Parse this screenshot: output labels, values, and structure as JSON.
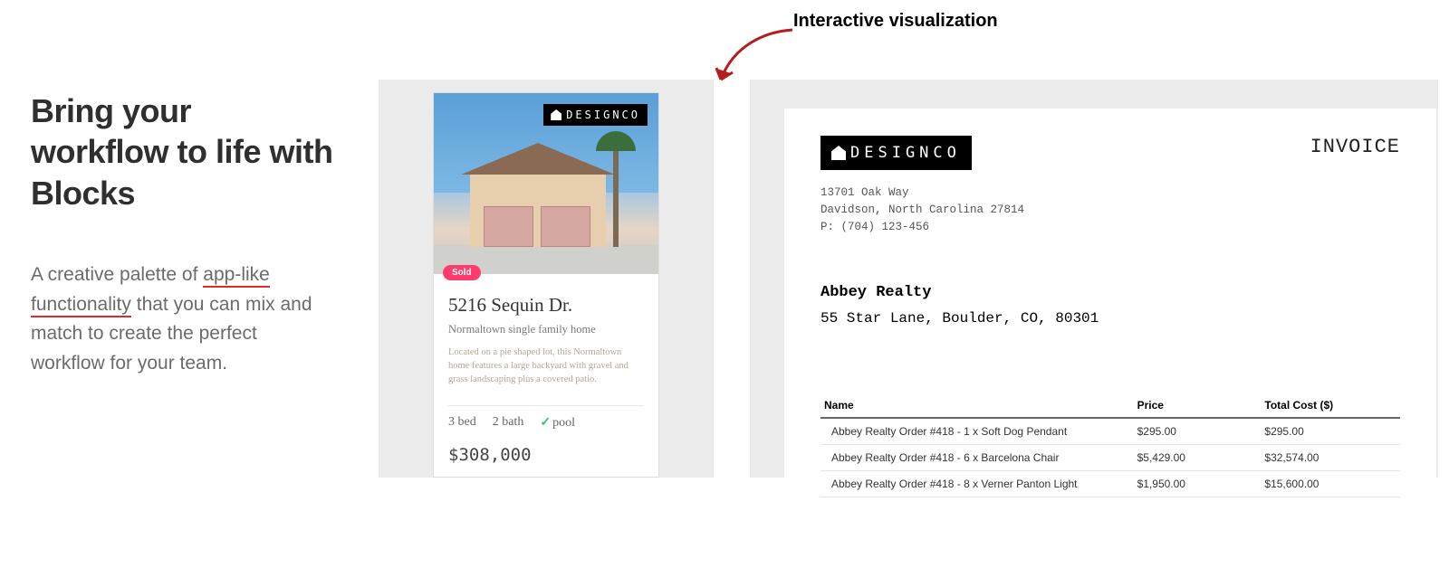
{
  "callout": {
    "label": "Interactive visualization"
  },
  "left": {
    "headline": "Bring your workflow to life with Blocks",
    "sub_pre": "A creative palette of ",
    "sub_link1": "app-like",
    "sub_mid": " ",
    "sub_link2": "functionality",
    "sub_post": " that you can mix and match to create the perfect workflow for your team."
  },
  "brand": {
    "name": "DESIGNCO"
  },
  "listing": {
    "sold_label": "Sold",
    "title": "5216 Sequin Dr.",
    "subtitle": "Normaltown single family home",
    "description": "Located on a pie shaped lot, this Normaltown home features a large backyard with gravel and grass landscaping plus a covered patio.",
    "beds": "3 bed",
    "baths": "2 bath",
    "pool_label": "pool",
    "price": "$308,000"
  },
  "invoice": {
    "doc_label": "INVOICE",
    "from_line1": "13701 Oak Way",
    "from_line2": "Davidson, North Carolina 27814",
    "from_line3": "P: (704) 123-456",
    "to_name": "Abbey Realty",
    "to_address": "55 Star Lane, Boulder, CO, 80301",
    "cols": {
      "name": "Name",
      "price": "Price",
      "total": "Total Cost ($)"
    },
    "rows": [
      {
        "name": "Abbey Realty Order #418 - 1 x Soft Dog Pendant",
        "price": "$295.00",
        "total": "$295.00"
      },
      {
        "name": "Abbey Realty Order #418 - 6 x Barcelona Chair",
        "price": "$5,429.00",
        "total": "$32,574.00"
      },
      {
        "name": "Abbey Realty Order #418 - 8 x Verner Panton Light",
        "price": "$1,950.00",
        "total": "$15,600.00"
      }
    ]
  }
}
